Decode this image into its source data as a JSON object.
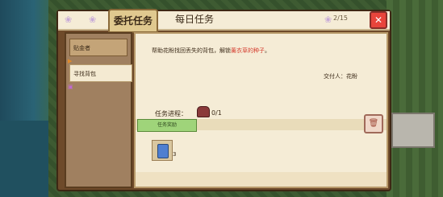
{
  "header": {
    "tabs": [
      {
        "label": "委托任务",
        "active": true
      },
      {
        "label": "每日任务",
        "active": false
      }
    ],
    "counter": "2/15",
    "close_label": "✕"
  },
  "quest_list": [
    {
      "label": "贴金者",
      "selected": false,
      "flag": true
    },
    {
      "label": "寻找背包",
      "selected": true,
      "flag": true
    }
  ],
  "detail": {
    "desc_prefix": "帮助花盼找回丢失的背包，解锁",
    "desc_highlight": "薰衣草的种子",
    "desc_suffix": "。",
    "giver": "交付人：花盼",
    "progress_label": "任务进程：",
    "progress_value": "0/1",
    "reward_tab": "任务奖励",
    "reward_qty": "3"
  },
  "colors": {
    "accent": "#e0c98f",
    "highlight": "#d43a2c",
    "close": "#e8453c"
  }
}
